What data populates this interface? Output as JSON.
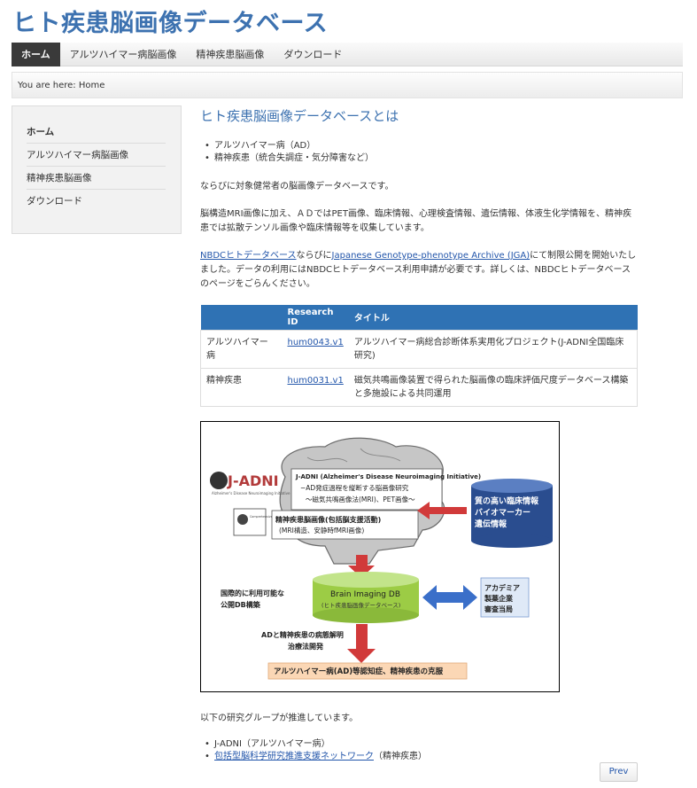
{
  "site_title": "ヒト疾患脳画像データベース",
  "nav": [
    "ホーム",
    "アルツハイマー病脳画像",
    "精神疾患脳画像",
    "ダウンロード"
  ],
  "breadcrumb": "You are here: Home",
  "sidebar": [
    "ホーム",
    "アルツハイマー病脳画像",
    "精神疾患脳画像",
    "ダウンロード"
  ],
  "main": {
    "heading": "ヒト疾患脳画像データベースとは",
    "bullets": [
      "アルツハイマー病（AD）",
      "精神疾患（統合失調症・気分障害など）"
    ],
    "p1": "ならびに対象健常者の脳画像データベースです。",
    "p2": "脳構造MRI画像に加え、ＡＤではPET画像、臨床情報、心理検査情報、遺伝情報、体液生化学情報を、精神疾患では拡散テンソル画像や臨床情報等を収集しています。",
    "p3_link1": "NBDCヒトデータベース",
    "p3_mid": "ならびに",
    "p3_link2": "Japanese Genotype-phenotype Archive (JGA)",
    "p3_rest": "にて制限公開を開始いたしました。データの利用にはNBDCヒトデータベース利用申請が必要です。詳しくは、NBDCヒトデータベースのページをごらんください。",
    "p4": "以下の研究グループが推進しています。",
    "groups": [
      {
        "text": "J-ADNI（アルツハイマー病）",
        "link": "",
        "suffix": ""
      },
      {
        "text": "",
        "link": "包括型脳科学研究推進支援ネットワーク",
        "suffix": "（精神疾患）"
      }
    ],
    "prev": "Prev"
  },
  "table": {
    "headers": [
      "",
      "Research ID",
      "タイトル"
    ],
    "rows": [
      {
        "disease": "アルツハイマー病",
        "id": "hum0043.v1",
        "title": "アルツハイマー病総合診断体系実用化プロジェクト(J-ADNI全国臨床研究)"
      },
      {
        "disease": "精神疾患",
        "id": "hum0031.v1",
        "title": "磁気共鳴画像装置で得られた脳画像の臨床評価尺度データベース構築と多施設による共同運用"
      }
    ]
  },
  "figure": {
    "jadni_logo": "J-ADNI",
    "jadni_logo_sub": "Alzheimer's Disease Neuroimaging Initiative",
    "jadni_title": "J-ADNI (Alzheimer's Disease Neuroimaging Initiative)",
    "jadni_line1": "−AD発症過程を縦断する脳画像研究",
    "jadni_line2": "〜磁気共鳴画像法(MRI)、PET画像〜",
    "cbsn_logo_text": "Comprehensive Brain Science Network",
    "psy_title": "精神疾患脳画像(包括脳支援活動)",
    "psy_sub": "(MRI構造、安静時fMRI画像)",
    "clinical": [
      "質の高い臨床情報",
      "バイオマーカー",
      "遺伝情報"
    ],
    "db_title": "Brain Imaging DB",
    "db_sub": "(ヒト疾患脳画像データベース)",
    "left_note": [
      "国際的に利用可能な",
      "公開DB構築"
    ],
    "users": [
      "アカデミア",
      "製薬企業",
      "審査当局"
    ],
    "down_note": [
      "ADと精神疾患の病態解明",
      "治療法開発"
    ],
    "bottom": "アルツハイマー病(AD)等認知症、精神疾患の克服",
    "colors": {
      "db": "#9ccc45",
      "arrow": "#d13a3a",
      "blue_arrow": "#3a6fc9",
      "clinical_box": "#2a4d8f",
      "bottom_box": "#fbd7b5"
    }
  }
}
